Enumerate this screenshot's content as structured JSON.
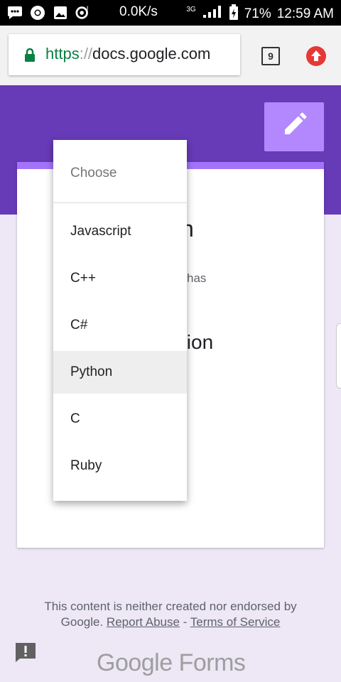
{
  "status_bar": {
    "speed": "0.0K/s",
    "network": "3G",
    "battery": "71%",
    "time": "12:59 AM"
  },
  "browser": {
    "url_scheme": "https",
    "url_sep": "://",
    "url_host": "docs.google.com",
    "tab_count": "9",
    "icons": [
      "lock-icon",
      "tab-switcher-icon",
      "update-icon"
    ]
  },
  "form": {
    "title_fragment": "n",
    "desc_fragment": "has",
    "question_fragment": "tion",
    "colors": {
      "header": "#673ab7",
      "edit_button": "#b388ff",
      "accent": "#a374f9"
    }
  },
  "dropdown": {
    "placeholder": "Choose",
    "options": [
      "Javascript",
      "C++",
      "C#",
      "Python",
      "C",
      "Ruby"
    ],
    "highlighted": "Python"
  },
  "footer": {
    "disclaimer_line1": "This content is neither created nor endorsed by",
    "disclaimer_google": "Google.",
    "report_abuse": "Report Abuse",
    "dash": "-",
    "terms": "Terms of Service",
    "brand_google": "Google",
    "brand_forms": "Forms"
  }
}
